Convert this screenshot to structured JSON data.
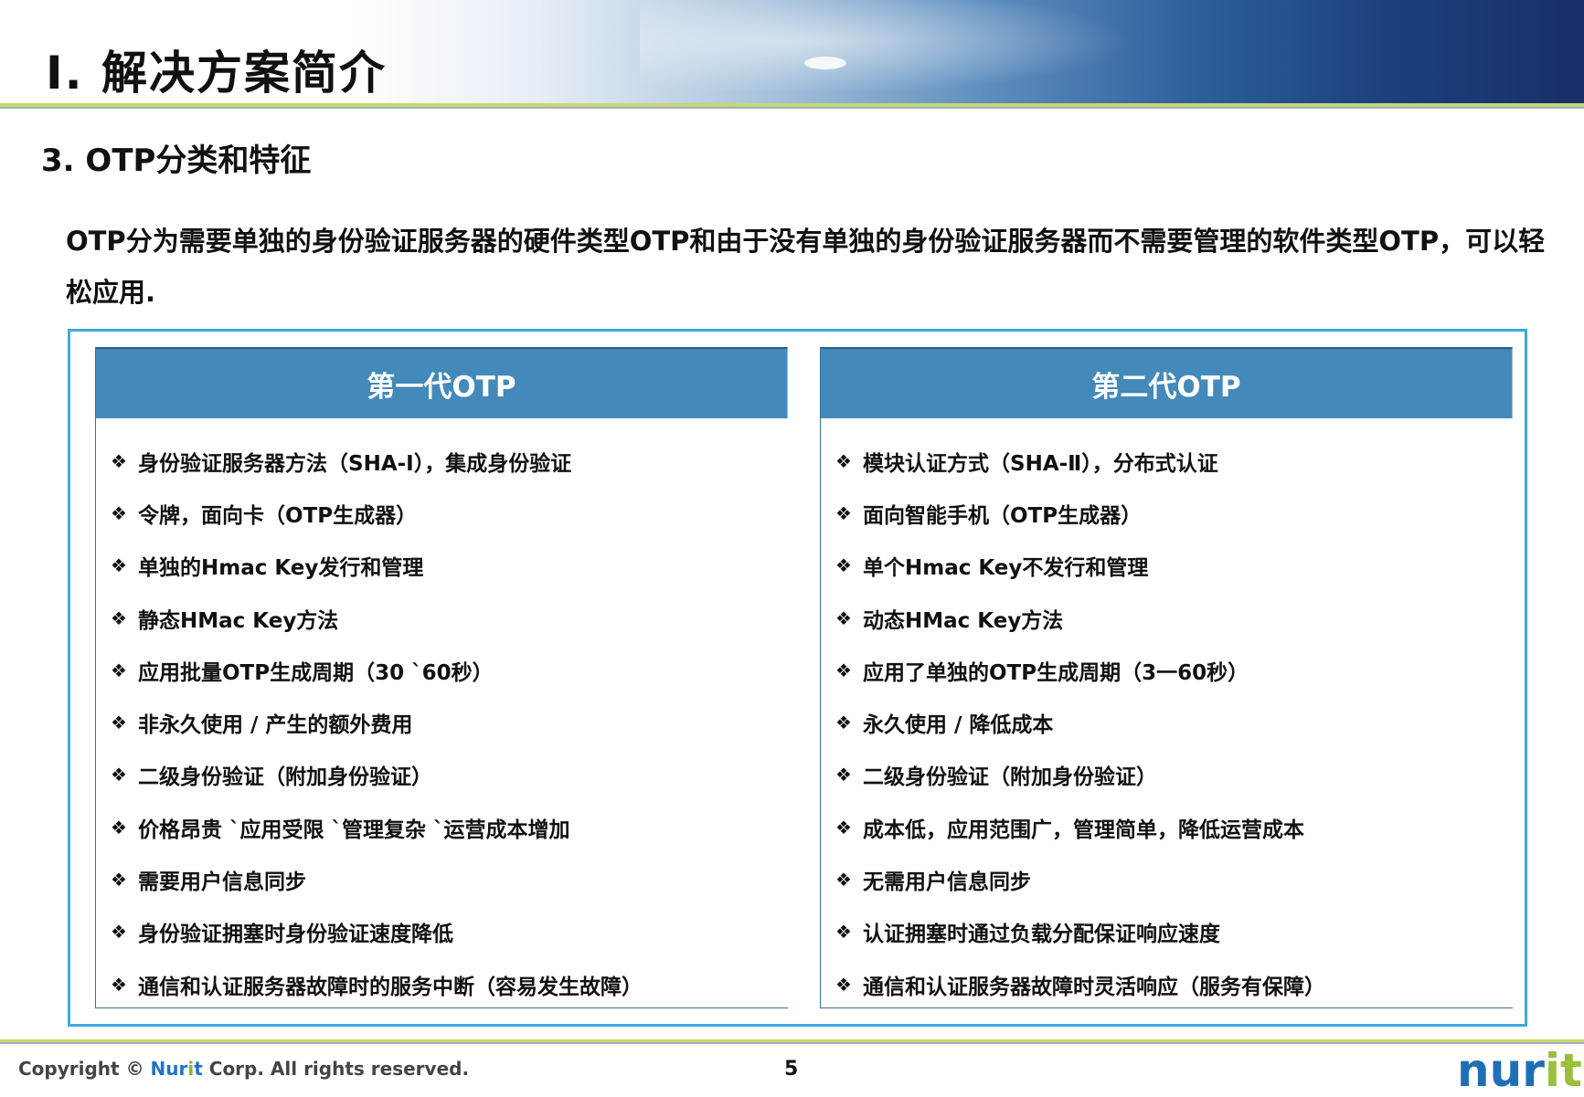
{
  "header": {
    "title": "Ⅰ. 解决方案简介"
  },
  "section": {
    "title": "3. OTP分类和特征"
  },
  "intro": {
    "text": "OTP分为需要单独的身份验证服务器的硬件类型OTP和由于没有单独的身份验证服务器而不需要管理的软件类型OTP，可以轻松应用."
  },
  "panels": {
    "first": {
      "title": "第一代OTP",
      "items": [
        "身份验证服务器方法（SHA-I），集成身份验证",
        "令牌，面向卡（OTP生成器）",
        "单独的Hmac Key发行和管理",
        "静态HMac Key方法",
        "应用批量OTP生成周期（30 `60秒）",
        "非永久使用 / 产生的额外费用",
        "二级身份验证（附加身份验证）",
        "价格昂贵 `应用受限 `管理复杂 `运营成本增加",
        "需要用户信息同步",
        "身份验证拥塞时身份验证速度降低",
        "通信和认证服务器故障时的服务中断（容易发生故障）"
      ]
    },
    "second": {
      "title": "第二代OTP",
      "items": [
        "模块认证方式（SHA-Ⅱ），分布式认证",
        "面向智能手机（OTP生成器）",
        "单个Hmac Key不发行和管理",
        "动态HMac Key方法",
        "应用了单独的OTP生成周期（3一60秒）",
        "永久使用 / 降低成本",
        "二级身份验证（附加身份验证）",
        "成本低，应用范围广，管理简单，降低运营成本",
        "无需用户信息同步",
        "认证拥塞时通过负载分配保证响应速度",
        "通信和认证服务器故障时灵活响应（服务有保障）"
      ]
    },
    "bullet_glyph": "❖"
  },
  "footer": {
    "copyright_prefix": "Copyright © ",
    "brand_part1": "Nur",
    "brand_part2": "i",
    "brand_part3": "t",
    "copyright_suffix": " Corp. All rights reserved.",
    "page_number": "5",
    "logo_part1": "nur",
    "logo_part2": "it"
  },
  "colors": {
    "panel_header": "#4389ba",
    "frame_border": "#3fa9e0",
    "accent_green": "#9ac03a",
    "brand_blue": "#1e6fb5"
  }
}
